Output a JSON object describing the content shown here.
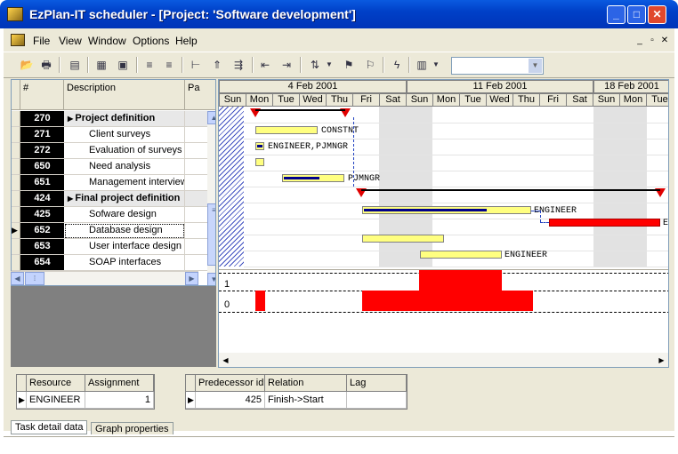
{
  "window": {
    "title": "EzPlan-IT scheduler - [Project: 'Software development']"
  },
  "menu": [
    "File",
    "View",
    "Window",
    "Options",
    "Help"
  ],
  "grid": {
    "headers": {
      "num": "#",
      "desc": "Description",
      "pa": "Pa"
    },
    "rows": [
      {
        "id": "270",
        "desc": "Project definition",
        "summary": true
      },
      {
        "id": "271",
        "desc": "Client surveys"
      },
      {
        "id": "272",
        "desc": "Evaluation of surveys"
      },
      {
        "id": "650",
        "desc": "Need analysis"
      },
      {
        "id": "651",
        "desc": "Management interview"
      },
      {
        "id": "424",
        "desc": "Final project definition",
        "summary": true
      },
      {
        "id": "425",
        "desc": "Sofware design"
      },
      {
        "id": "652",
        "desc": "Database design",
        "current": true
      },
      {
        "id": "653",
        "desc": "User interface design"
      },
      {
        "id": "654",
        "desc": "SOAP interfaces"
      }
    ]
  },
  "gantt": {
    "weeks": [
      "4 Feb 2001",
      "11 Feb 2001",
      "18 Feb 2001"
    ],
    "days": [
      "Sun",
      "Mon",
      "Tue",
      "Wed",
      "Thu",
      "Fri",
      "Sat",
      "Sun",
      "Mon",
      "Tue",
      "Wed",
      "Thu",
      "Fri",
      "Sat",
      "Sun",
      "Mon",
      "Tue"
    ],
    "labels": {
      "r271": "CONSTNT",
      "r272": "ENGINEER,PJMNGR",
      "r651": "PJMNGR",
      "r425": "ENGINEER",
      "r652": "E",
      "r654": "ENGINEER"
    },
    "histogram_levels": [
      "1",
      "0"
    ]
  },
  "resources": {
    "headers": [
      "Resource",
      "Assignment"
    ],
    "rows": [
      {
        "resource": "ENGINEER",
        "assignment": "1"
      }
    ]
  },
  "predecessors": {
    "headers": [
      "Predecessor id",
      "Relation",
      "Lag"
    ],
    "rows": [
      {
        "id": "425",
        "relation": "Finish->Start",
        "lag": ""
      }
    ]
  },
  "tabs": [
    "Task detail data",
    "Graph properties"
  ],
  "colors": {
    "titlebar": "#0040c8",
    "bar": "#ffff80",
    "critical": "#ff0000",
    "milestone": "#e00000"
  }
}
